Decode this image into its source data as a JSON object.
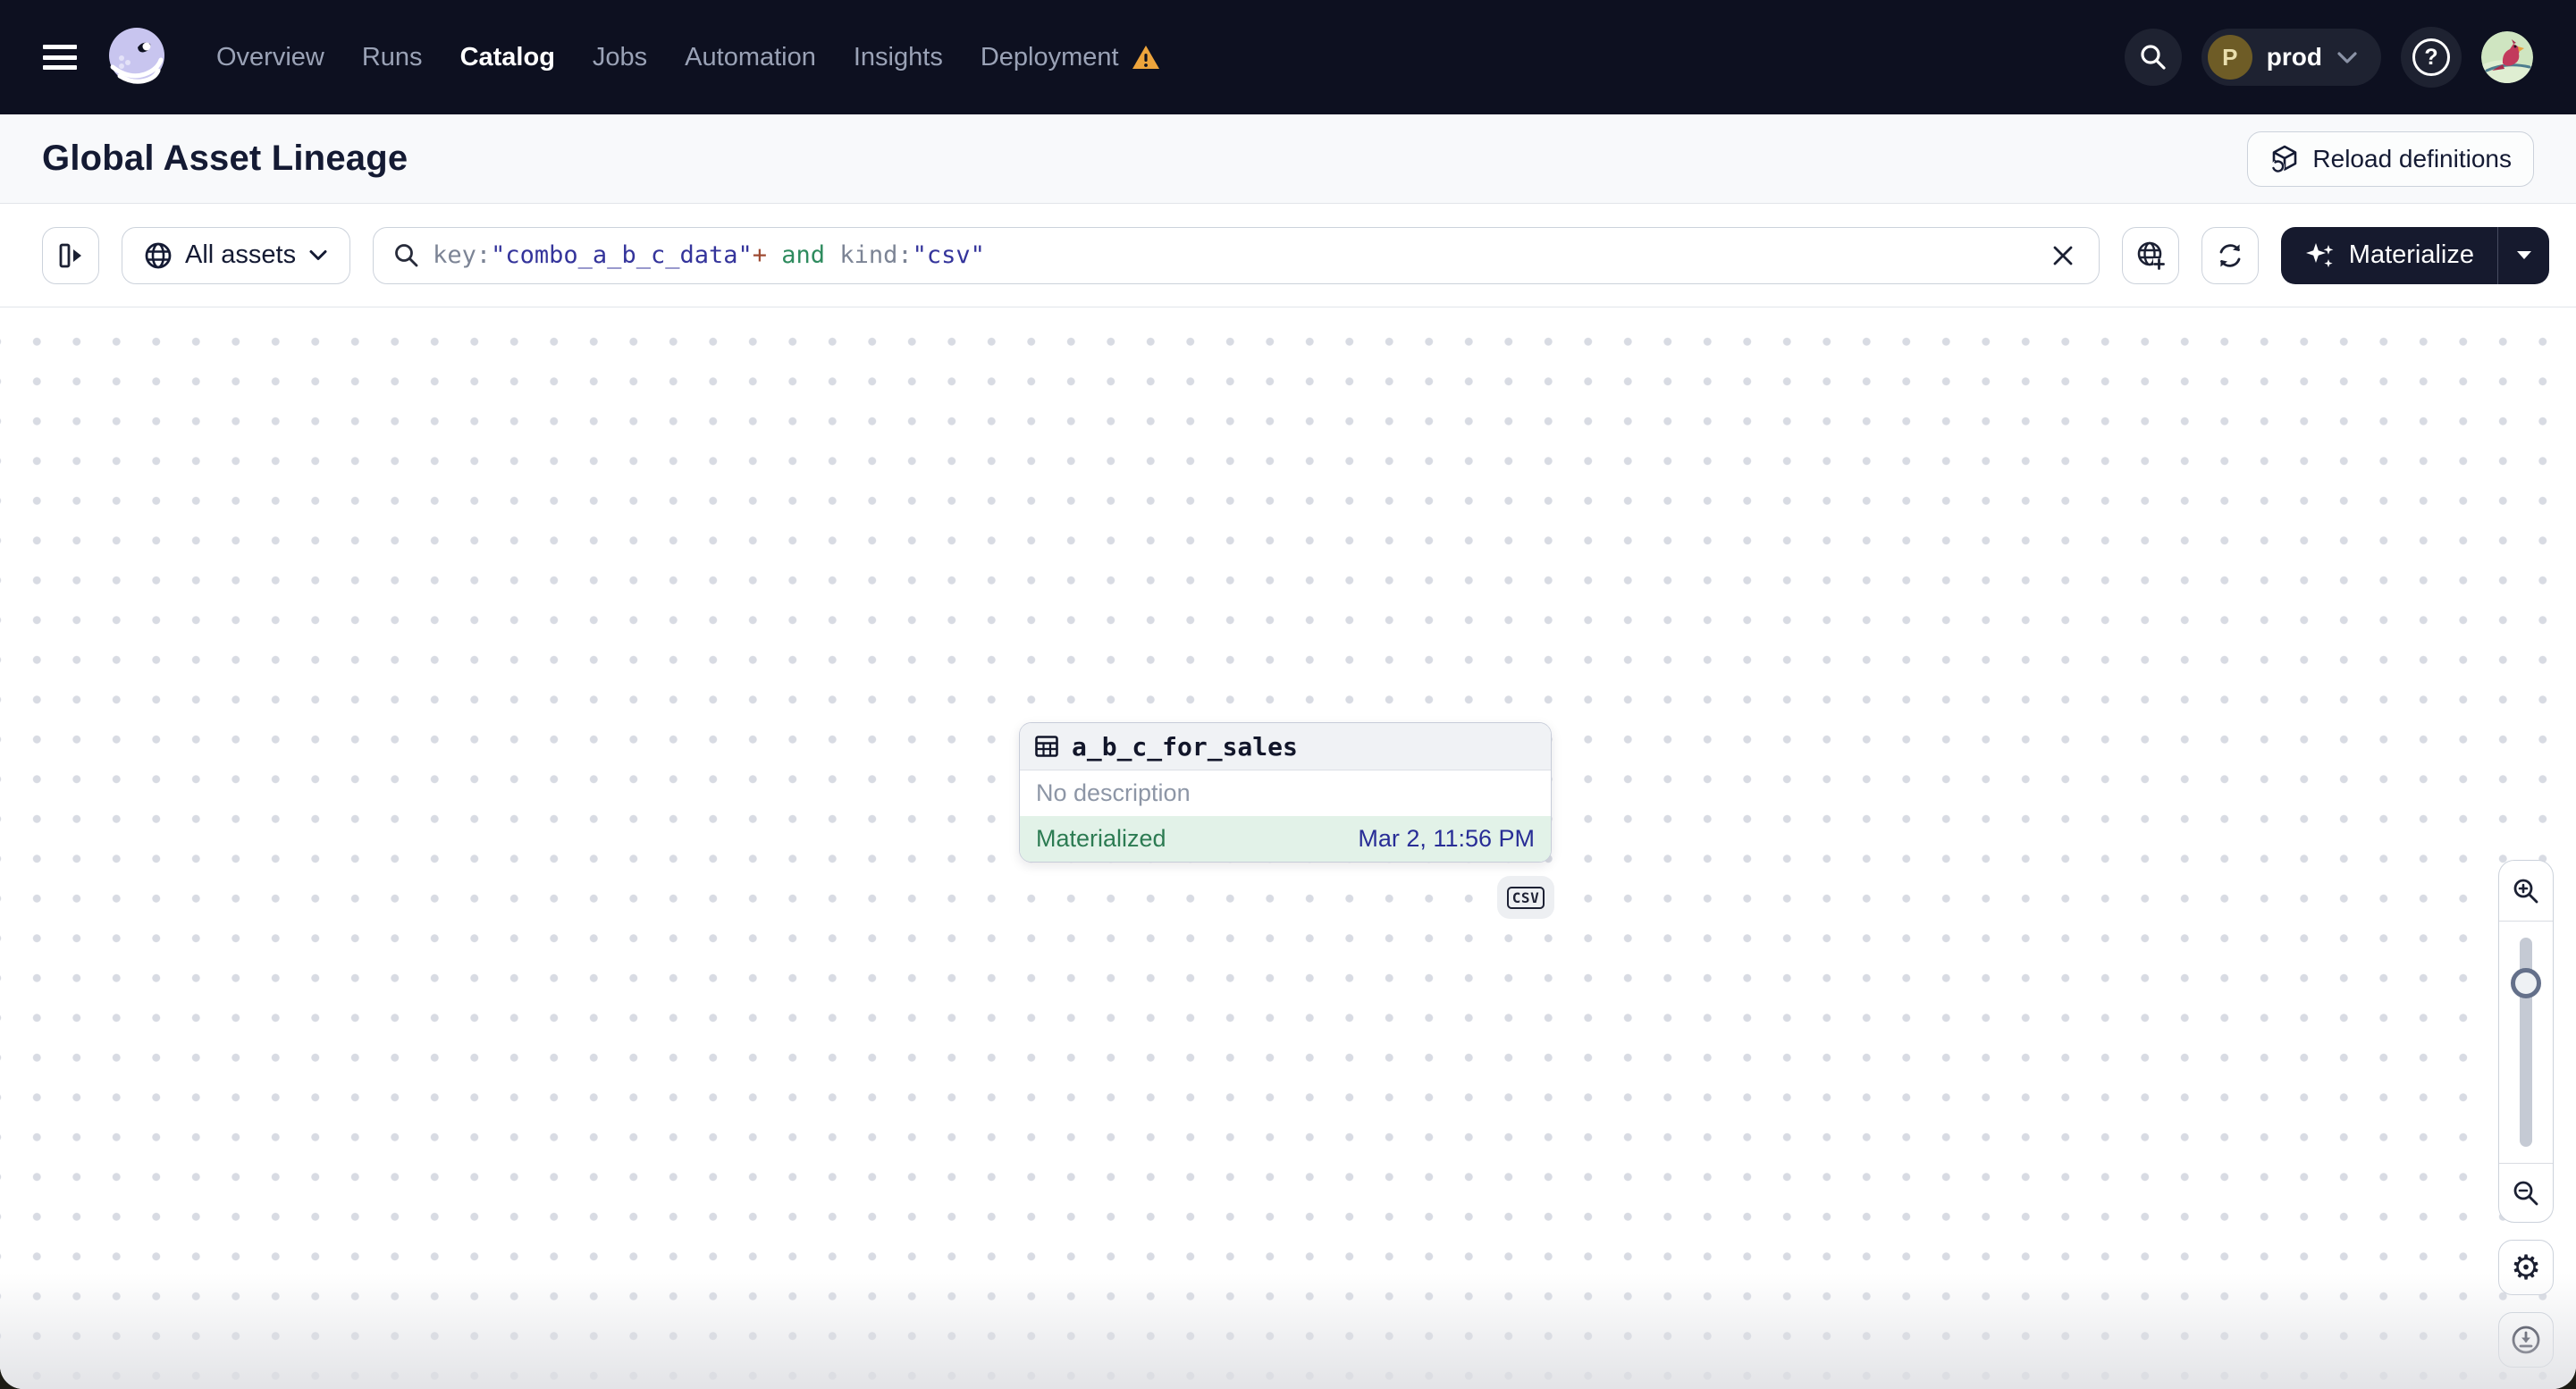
{
  "topnav": {
    "items": [
      {
        "label": "Overview"
      },
      {
        "label": "Runs"
      },
      {
        "label": "Catalog"
      },
      {
        "label": "Jobs"
      },
      {
        "label": "Automation"
      },
      {
        "label": "Insights"
      },
      {
        "label": "Deployment"
      }
    ],
    "active_item": "Catalog",
    "deployment_has_warning": true,
    "environment": {
      "initial": "P",
      "name": "prod"
    }
  },
  "header": {
    "title": "Global Asset Lineage",
    "reload_button_label": "Reload definitions"
  },
  "toolbar": {
    "filter_label": "All assets",
    "search": {
      "query": "key:\"combo_a_b_c_data\"+ and kind:\"csv\"",
      "segments": [
        {
          "type": "field",
          "text": "key:"
        },
        {
          "type": "value",
          "text": "\"combo_a_b_c_data\""
        },
        {
          "type": "operator",
          "text": "+"
        },
        {
          "type": "plain",
          "text": " "
        },
        {
          "type": "logic",
          "text": "and"
        },
        {
          "type": "plain",
          "text": " "
        },
        {
          "type": "field",
          "text": "kind:"
        },
        {
          "type": "value",
          "text": "\"csv\""
        }
      ]
    },
    "materialize_label": "Materialize"
  },
  "canvas": {
    "asset_node": {
      "title": "a_b_c_for_sales",
      "description": "No description",
      "status": "Materialized",
      "last_materialization": "Mar 2, 11:56 PM",
      "kind": "CSV"
    }
  },
  "colors": {
    "nav_background": "#0d1020",
    "brand_lavender": "#c8c5ef",
    "warning_orange": "#eda43c",
    "status_green": "#2c7b52",
    "status_green_bg": "#e2f2e8",
    "timestamp_indigo": "#282d96",
    "query_value_indigo": "#34349b",
    "query_operator_red": "#9e4b33",
    "query_logic_green": "#2e8b5e"
  }
}
